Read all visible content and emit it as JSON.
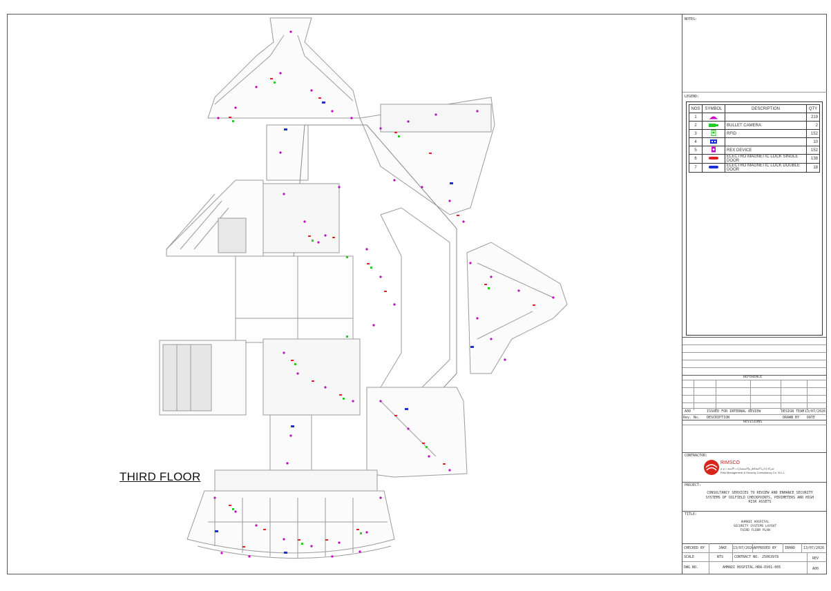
{
  "drawing": {
    "floor_label": "THIRD FLOOR"
  },
  "title_block": {
    "notes_label": "NOTES:",
    "legend_label": "LEGEND:",
    "legend_headers": [
      "NOS",
      "SYMBOL",
      "DESCRIPTION",
      "QTY"
    ],
    "legend_rows": [
      {
        "no": "1",
        "symbol": "dome-camera-icon",
        "desc": "",
        "qty": "219",
        "color": "#c400c4"
      },
      {
        "no": "2",
        "symbol": "bullet-camera-icon",
        "desc": "BULLET CAMERA",
        "qty": "2",
        "color": "#22cc22"
      },
      {
        "no": "3",
        "symbol": "rfid-icon",
        "desc": "RFID",
        "qty": "152",
        "color": "#22cc22"
      },
      {
        "no": "4",
        "symbol": "blue-device-icon",
        "desc": "",
        "qty": "10",
        "color": "#1e2fd6"
      },
      {
        "no": "5",
        "symbol": "rex-device-icon",
        "desc": "REX DEVICE",
        "qty": "152",
        "color": "#c400c4"
      },
      {
        "no": "6",
        "symbol": "maglock-single-icon",
        "desc": "ELECTRO MAGNETIC LOCK SINGLE DOOR",
        "qty": "138",
        "color": "#e02020"
      },
      {
        "no": "7",
        "symbol": "maglock-double-icon",
        "desc": "ELECTRO MAGNETIC LOCK DOUBLE DOOR",
        "qty": "18",
        "color": "#1e2fd6"
      }
    ],
    "reference_label": "REFERENCE",
    "revision": {
      "rev": "A00",
      "description": "ISSUED FOR INTERNAL REVIEW",
      "drawn_by": "DESIGN TEAM",
      "date": "13/07/2026"
    },
    "rev_headers": {
      "rev_no": "Rev. No.",
      "description": "DESCRIPTION",
      "drawn_by": "DRAWN BY",
      "date": "DATE"
    },
    "revisions_label": "REVISIONS",
    "contractor_label": "CONTRACTOR:",
    "contractor_name": "RIMSCO",
    "contractor_arabic": "شركة إدارة المخاطر والاستشارات الأمنية ذ.م.م",
    "contractor_sub": "Risk Management & Security Consultancy Co. W.L.L.",
    "project_label": "PROJECT:",
    "project_text": "CONSULTANCY SERVICES TO REVIEW AND ENHANCE SECURITY SYSTEMS OF OILFIELD CHECKPOINTS, PERIMETERS AND HIGH RISK ASSETS",
    "title_label": "TITLE:",
    "title_lines": [
      "AHMADI HOSPITAL",
      "SECURITY SYSTEMS LAYOUT",
      "THIRD FLOOR PLAN"
    ],
    "checked_by_label": "CHECKED BY",
    "checked_by": "JAKE",
    "checked_date": "13/07/2026",
    "approved_by_label": "APPROVED BY",
    "approved_by": "IRHAD",
    "approved_date": "13/07/2026",
    "scale_label": "SCALE",
    "scale": "NTS",
    "contract_label": "CONTRACT NO.",
    "contract_no": "25063978",
    "rev_label": "REV",
    "dwg_label": "DWG NO.",
    "dwg_no": "AHMADI HOSPITAL-HRA-DV01-005",
    "rev_value": "A00"
  },
  "colors": {
    "camera": "#c400c4",
    "rfid": "#22cc22",
    "lock_single": "#e02020",
    "lock_double": "#1e2fd6",
    "wall": "#9a9a9a"
  }
}
